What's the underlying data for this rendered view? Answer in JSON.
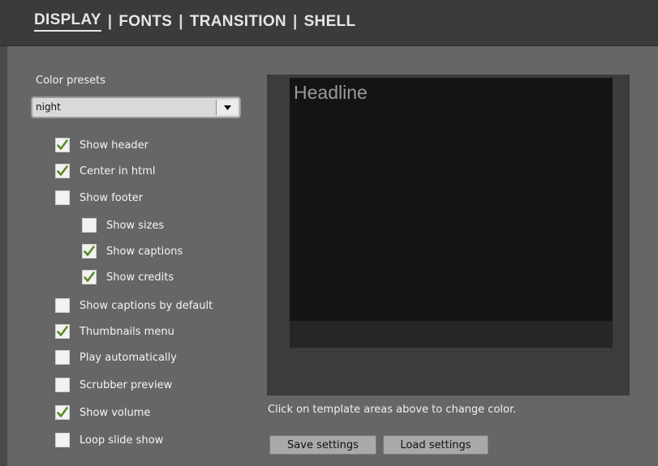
{
  "tabs": [
    {
      "label": "DISPLAY",
      "active": true
    },
    {
      "label": "FONTS",
      "active": false
    },
    {
      "label": "TRANSITION",
      "active": false
    },
    {
      "label": "SHELL",
      "active": false
    }
  ],
  "tab_separator": "|",
  "color_presets": {
    "label": "Color presets",
    "selected": "night"
  },
  "options": [
    {
      "label": "Show header",
      "checked": true
    },
    {
      "label": "Center in html",
      "checked": true
    },
    {
      "label": "Show footer",
      "checked": false
    },
    {
      "label": "Show sizes",
      "checked": false
    },
    {
      "label": "Show captions",
      "checked": true
    },
    {
      "label": "Show credits",
      "checked": true
    },
    {
      "label": "Show captions by default",
      "checked": false
    },
    {
      "label": "Thumbnails menu",
      "checked": true
    },
    {
      "label": "Play automatically",
      "checked": false
    },
    {
      "label": "Scrubber preview",
      "checked": false
    },
    {
      "label": "Show volume",
      "checked": true
    },
    {
      "label": "Loop slide show",
      "checked": false
    }
  ],
  "preview": {
    "headline": "Headline",
    "hint": "Click on template areas above to change color."
  },
  "buttons": {
    "save": "Save settings",
    "load": "Load settings"
  },
  "colors": {
    "check": "#5a8a2a",
    "panel_bg": "#666666",
    "header_bg": "#3b3b3b",
    "preview_bg": "#141414"
  }
}
